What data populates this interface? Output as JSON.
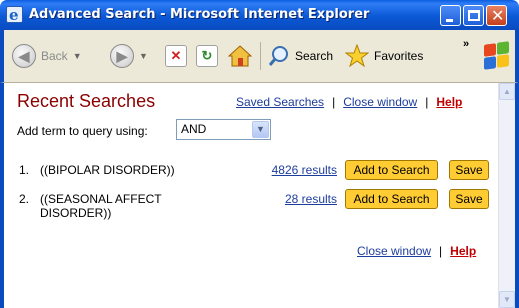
{
  "window": {
    "title": "Advanced Search - Microsoft Internet Explorer",
    "title_icon": "ie-logo-icon"
  },
  "toolbar": {
    "back_label": "Back",
    "search_label": "Search",
    "favorites_label": "Favorites",
    "overflow_label": "»"
  },
  "page": {
    "heading": "Recent Searches",
    "saved_searches_link": "Saved Searches",
    "close_window_link": "Close window",
    "help_link": "Help",
    "separator": "|",
    "add_term_label": "Add term to query using:",
    "operator_value": "AND",
    "searches": [
      {
        "num": "1.",
        "term": "((BIPOLAR DISORDER))",
        "results": "4826 results",
        "add_label": "Add to Search",
        "save_label": "Save"
      },
      {
        "num": "2.",
        "term": "((SEASONAL AFFECT DISORDER))",
        "results": "28 results",
        "add_label": "Add to Search",
        "save_label": "Save"
      }
    ],
    "bottom_close_window_link": "Close window",
    "bottom_help_link": "Help"
  },
  "colors": {
    "heading": "#8b0000",
    "link": "#1d3d9c",
    "help": "#c00000",
    "button": "#ffcc33",
    "titlebar": "#0b58d6"
  }
}
